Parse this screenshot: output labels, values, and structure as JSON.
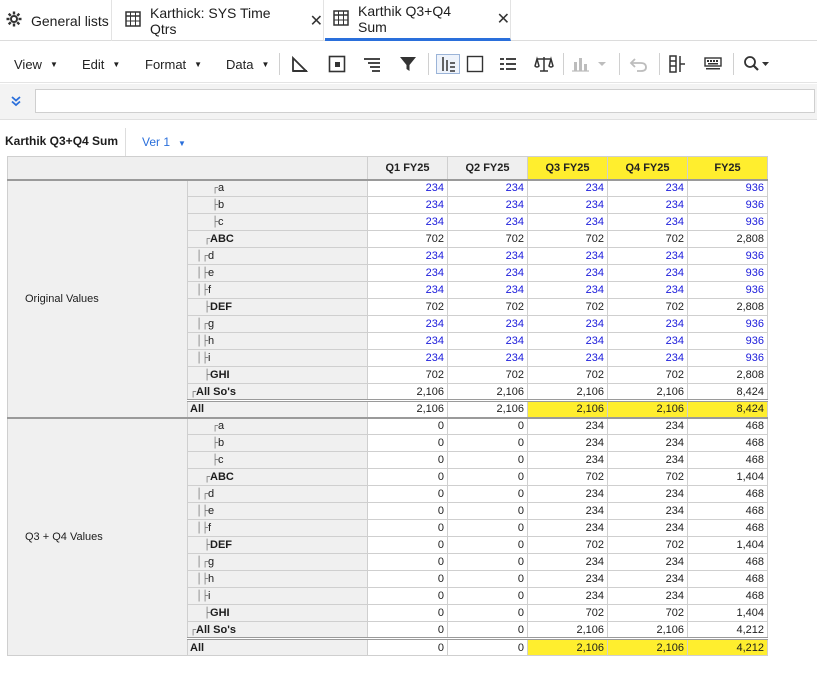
{
  "tabs": [
    {
      "label": "General lists",
      "icon": "gear-icon",
      "closable": false,
      "active": false
    },
    {
      "label": "Karthick: SYS Time Qtrs",
      "icon": "grid-icon",
      "closable": true,
      "active": false
    },
    {
      "label": "Karthik Q3+Q4 Sum",
      "icon": "grid-icon",
      "closable": true,
      "active": true
    }
  ],
  "toolbar": {
    "menus": [
      "View",
      "Edit",
      "Format",
      "Data"
    ],
    "icons": [
      "measure-icon",
      "grid-frame-icon",
      "indent-icon",
      "filter-icon",
      "pivot-icon",
      "checkbox-icon",
      "list-icon",
      "balance-icon",
      "chart-icon",
      "undo-icon",
      "insert-column-icon",
      "keyboard-icon",
      "search-icon"
    ]
  },
  "formula_bar": {
    "value": "",
    "placeholder": ""
  },
  "sheet": {
    "name": "Karthik Q3+Q4 Sum",
    "version": "Ver 1"
  },
  "grid": {
    "columns": [
      "Q1 FY25",
      "Q2 FY25",
      "Q3 FY25",
      "Q4 FY25",
      "FY25"
    ],
    "highlight_color": "#ffee2e",
    "groups": [
      {
        "label": "Original Values",
        "rows": [
          {
            "member": "a",
            "tree": "┌",
            "level": 3,
            "kind": "input",
            "values": [
              "234",
              "234",
              "234",
              "234",
              "936"
            ]
          },
          {
            "member": "b",
            "tree": "├",
            "level": 3,
            "kind": "input",
            "values": [
              "234",
              "234",
              "234",
              "234",
              "936"
            ]
          },
          {
            "member": "c",
            "tree": "├",
            "level": 3,
            "kind": "input",
            "values": [
              "234",
              "234",
              "234",
              "234",
              "936"
            ]
          },
          {
            "member": "ABC",
            "tree": "┌",
            "level": 1,
            "kind": "calc",
            "bold": true,
            "values": [
              "702",
              "702",
              "702",
              "702",
              "2,808"
            ]
          },
          {
            "member": "d",
            "tree": "│┌",
            "level": 2,
            "kind": "input",
            "values": [
              "234",
              "234",
              "234",
              "234",
              "936"
            ]
          },
          {
            "member": "e",
            "tree": "│├",
            "level": 2,
            "kind": "input",
            "values": [
              "234",
              "234",
              "234",
              "234",
              "936"
            ]
          },
          {
            "member": "f",
            "tree": "│├",
            "level": 2,
            "kind": "input",
            "values": [
              "234",
              "234",
              "234",
              "234",
              "936"
            ]
          },
          {
            "member": "DEF",
            "tree": "├",
            "level": 1,
            "kind": "calc",
            "bold": true,
            "values": [
              "702",
              "702",
              "702",
              "702",
              "2,808"
            ]
          },
          {
            "member": "g",
            "tree": "│┌",
            "level": 2,
            "kind": "input",
            "values": [
              "234",
              "234",
              "234",
              "234",
              "936"
            ]
          },
          {
            "member": "h",
            "tree": "│├",
            "level": 2,
            "kind": "input",
            "values": [
              "234",
              "234",
              "234",
              "234",
              "936"
            ]
          },
          {
            "member": "i",
            "tree": "│├",
            "level": 2,
            "kind": "input",
            "values": [
              "234",
              "234",
              "234",
              "234",
              "936"
            ]
          },
          {
            "member": "GHI",
            "tree": "├",
            "level": 1,
            "kind": "calc",
            "bold": true,
            "values": [
              "702",
              "702",
              "702",
              "702",
              "2,808"
            ]
          },
          {
            "member": "All So's",
            "tree": "┌",
            "level": 0,
            "kind": "calc",
            "bold": true,
            "values": [
              "2,106",
              "2,106",
              "2,106",
              "2,106",
              "8,424"
            ]
          },
          {
            "member": "All",
            "tree": "",
            "level": 0,
            "kind": "calc",
            "bold": true,
            "total": true,
            "highlight": [
              2,
              3,
              4
            ],
            "values": [
              "2,106",
              "2,106",
              "2,106",
              "2,106",
              "8,424"
            ]
          }
        ]
      },
      {
        "label": "Q3 + Q4 Values",
        "rows": [
          {
            "member": "a",
            "tree": "┌",
            "level": 3,
            "kind": "calc",
            "values": [
              "0",
              "0",
              "234",
              "234",
              "468"
            ]
          },
          {
            "member": "b",
            "tree": "├",
            "level": 3,
            "kind": "calc",
            "values": [
              "0",
              "0",
              "234",
              "234",
              "468"
            ]
          },
          {
            "member": "c",
            "tree": "├",
            "level": 3,
            "kind": "calc",
            "values": [
              "0",
              "0",
              "234",
              "234",
              "468"
            ]
          },
          {
            "member": "ABC",
            "tree": "┌",
            "level": 1,
            "kind": "calc",
            "bold": true,
            "values": [
              "0",
              "0",
              "702",
              "702",
              "1,404"
            ]
          },
          {
            "member": "d",
            "tree": "│┌",
            "level": 2,
            "kind": "calc",
            "values": [
              "0",
              "0",
              "234",
              "234",
              "468"
            ]
          },
          {
            "member": "e",
            "tree": "│├",
            "level": 2,
            "kind": "calc",
            "values": [
              "0",
              "0",
              "234",
              "234",
              "468"
            ]
          },
          {
            "member": "f",
            "tree": "│├",
            "level": 2,
            "kind": "calc",
            "values": [
              "0",
              "0",
              "234",
              "234",
              "468"
            ]
          },
          {
            "member": "DEF",
            "tree": "├",
            "level": 1,
            "kind": "calc",
            "bold": true,
            "values": [
              "0",
              "0",
              "702",
              "702",
              "1,404"
            ]
          },
          {
            "member": "g",
            "tree": "│┌",
            "level": 2,
            "kind": "calc",
            "values": [
              "0",
              "0",
              "234",
              "234",
              "468"
            ]
          },
          {
            "member": "h",
            "tree": "│├",
            "level": 2,
            "kind": "calc",
            "values": [
              "0",
              "0",
              "234",
              "234",
              "468"
            ]
          },
          {
            "member": "i",
            "tree": "│├",
            "level": 2,
            "kind": "calc",
            "values": [
              "0",
              "0",
              "234",
              "234",
              "468"
            ]
          },
          {
            "member": "GHI",
            "tree": "├",
            "level": 1,
            "kind": "calc",
            "bold": true,
            "values": [
              "0",
              "0",
              "702",
              "702",
              "1,404"
            ]
          },
          {
            "member": "All So's",
            "tree": "┌",
            "level": 0,
            "kind": "calc",
            "bold": true,
            "values": [
              "0",
              "0",
              "2,106",
              "2,106",
              "4,212"
            ]
          },
          {
            "member": "All",
            "tree": "",
            "level": 0,
            "kind": "calc",
            "bold": true,
            "total": true,
            "highlight": [
              2,
              3,
              4
            ],
            "values": [
              "0",
              "0",
              "2,106",
              "2,106",
              "4,212"
            ]
          }
        ]
      }
    ]
  }
}
